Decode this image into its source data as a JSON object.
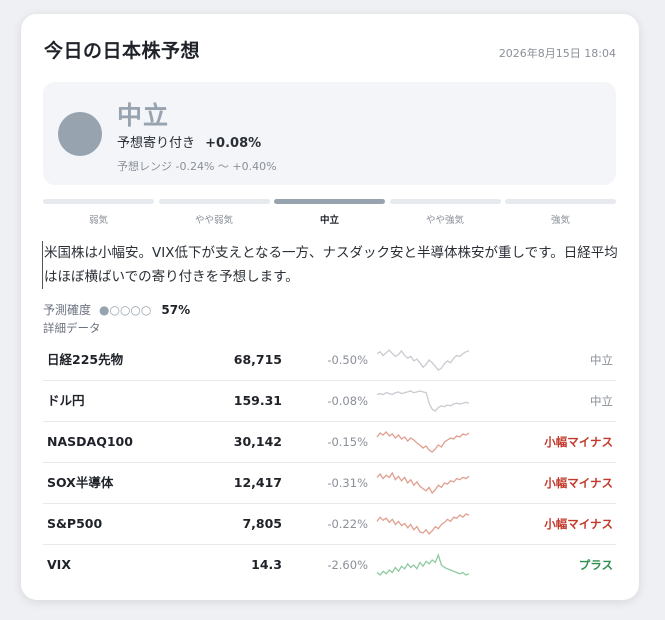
{
  "header": {
    "title": "今日の日本株予想",
    "timestamp": "2026年8月15日 18:04"
  },
  "summary": {
    "sentiment": "中立",
    "forecast_label": "予想寄り付き",
    "forecast_value": "+0.08%",
    "range_text": "予想レンジ -0.24% 〜 +0.40%",
    "color": "#98a3b0"
  },
  "scale": {
    "labels": [
      "弱気",
      "やや弱気",
      "中立",
      "やや強気",
      "強気"
    ],
    "active_index": 2
  },
  "comment": "米国株は小幅安。VIX低下が支えとなる一方、ナスダック安と半導体株安が重しです。日経平均はほぼ横ばいでの寄り付きを予想します。",
  "confidence": {
    "label": "予測確度",
    "dots": "●○○○○",
    "filled": 1,
    "total": 5,
    "value": "57%"
  },
  "detail": {
    "heading": "詳細データ",
    "rows": [
      {
        "name": "日経225先物",
        "value": "68,715",
        "change": "-0.50%",
        "tag": "中立",
        "tag_type": "neutral",
        "spark_color": "#c8cbd0",
        "spark": [
          60,
          62,
          58,
          61,
          64,
          60,
          57,
          59,
          63,
          58,
          55,
          57,
          52,
          54,
          50,
          45,
          48,
          53,
          50,
          46,
          42,
          44,
          49,
          52,
          50,
          55,
          58,
          57,
          60,
          62,
          63
        ]
      },
      {
        "name": "ドル円",
        "value": "159.31",
        "change": "-0.08%",
        "tag": "中立",
        "tag_type": "neutral",
        "spark_color": "#c8cbd0",
        "spark": [
          55,
          56,
          55,
          57,
          56,
          55,
          57,
          58,
          56,
          57,
          58,
          59,
          57,
          58,
          59,
          58,
          57,
          45,
          38,
          36,
          40,
          42,
          41,
          43,
          42,
          44,
          45,
          44,
          45,
          46,
          45
        ]
      },
      {
        "name": "NASDAQ100",
        "value": "30,142",
        "change": "-0.15%",
        "tag": "小幅マイナス",
        "tag_type": "minus",
        "spark_color": "#e0a090",
        "spark": [
          58,
          62,
          60,
          63,
          59,
          61,
          57,
          60,
          56,
          58,
          54,
          57,
          55,
          52,
          50,
          47,
          49,
          45,
          43,
          46,
          50,
          48,
          53,
          55,
          57,
          56,
          59,
          58,
          61,
          60,
          62
        ]
      },
      {
        "name": "SOX半導体",
        "value": "12,417",
        "change": "-0.31%",
        "tag": "小幅マイナス",
        "tag_type": "minus",
        "spark_color": "#e0a090",
        "spark": [
          60,
          63,
          59,
          62,
          60,
          64,
          58,
          61,
          57,
          60,
          55,
          58,
          53,
          56,
          52,
          50,
          48,
          51,
          46,
          49,
          53,
          51,
          55,
          54,
          57,
          56,
          59,
          58,
          60,
          59,
          61
        ]
      },
      {
        "name": "S&P500",
        "value": "7,805",
        "change": "-0.22%",
        "tag": "小幅マイナス",
        "tag_type": "minus",
        "spark_color": "#e0a090",
        "spark": [
          58,
          62,
          59,
          61,
          57,
          60,
          55,
          58,
          54,
          56,
          52,
          55,
          50,
          53,
          48,
          47,
          50,
          46,
          49,
          53,
          51,
          55,
          57,
          60,
          58,
          62,
          61,
          64,
          62,
          65,
          64
        ]
      },
      {
        "name": "VIX",
        "value": "14.3",
        "change": "-2.60%",
        "tag": "プラス",
        "tag_type": "plus",
        "spark_color": "#8fc9a0",
        "spark": [
          46,
          44,
          47,
          45,
          48,
          46,
          50,
          47,
          51,
          49,
          53,
          50,
          52,
          49,
          54,
          51,
          55,
          53,
          56,
          54,
          60,
          52,
          50,
          49,
          48,
          47,
          46,
          45,
          46,
          44,
          45
        ]
      }
    ]
  }
}
